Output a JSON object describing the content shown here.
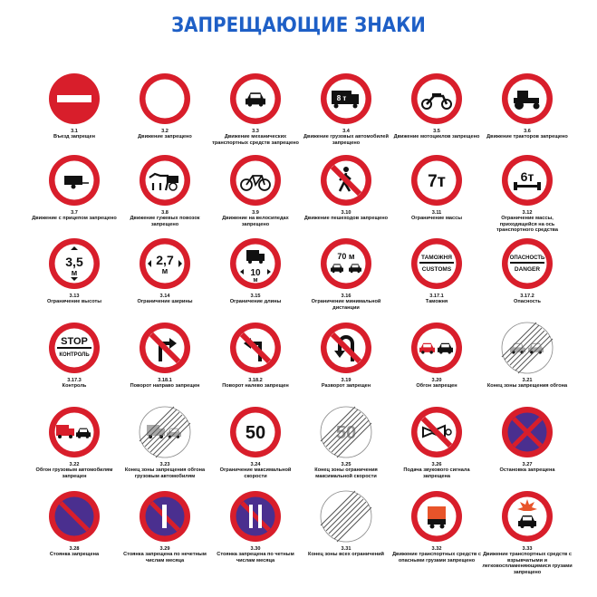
{
  "title": "ЗАПРЕЩАЮЩИЕ ЗНАКИ",
  "signs": [
    {
      "num": "3.1",
      "text": "Въезд запрещен",
      "icon": "no-entry"
    },
    {
      "num": "3.2",
      "text": "Движение запрещено",
      "icon": "plain"
    },
    {
      "num": "3.3",
      "text": "Движение механических транспортных средств запрещено",
      "icon": "car"
    },
    {
      "num": "3.4",
      "text": "Движение грузовых автомобилей запрещено",
      "icon": "truck",
      "label": "8 т"
    },
    {
      "num": "3.5",
      "text": "Движение мотоциклов запрещено",
      "icon": "motorcycle"
    },
    {
      "num": "3.6",
      "text": "Движение тракторов запрещено",
      "icon": "tractor"
    },
    {
      "num": "3.7",
      "text": "Движение с прицепом запрещено",
      "icon": "trailer"
    },
    {
      "num": "3.8",
      "text": "Движение гужевых повозок запрещено",
      "icon": "horse-cart"
    },
    {
      "num": "3.9",
      "text": "Движение на велосипедах запрещено",
      "icon": "bicycle"
    },
    {
      "num": "3.10",
      "text": "Движение пешеходов запрещено",
      "icon": "pedestrian"
    },
    {
      "num": "3.11",
      "text": "Ограничение массы",
      "icon": "text-big",
      "label": "7т"
    },
    {
      "num": "3.12",
      "text": "Ограничение массы, приходящейся на ось транспортного средства",
      "icon": "axle",
      "label": "6т"
    },
    {
      "num": "3.13",
      "text": "Ограничение высоты",
      "icon": "height",
      "label": "3,5",
      "unit": "м"
    },
    {
      "num": "3.14",
      "text": "Ограничение ширины",
      "icon": "width",
      "label": "2,7",
      "unit": "м"
    },
    {
      "num": "3.15",
      "text": "Ограничение длины",
      "icon": "length",
      "label": "10",
      "unit": "м"
    },
    {
      "num": "3.16",
      "text": "Ограничение минимальной дистанции",
      "icon": "distance",
      "label": "70 м"
    },
    {
      "num": "3.17.1",
      "text": "Таможня",
      "icon": "customs",
      "label": "ТАМОЖНЯ",
      "label2": "CUSTOMS"
    },
    {
      "num": "3.17.2",
      "text": "Опасность",
      "icon": "danger",
      "label": "ОПАСНОСТЬ",
      "label2": "DANGER"
    },
    {
      "num": "3.17.3",
      "text": "Контроль",
      "icon": "stop",
      "label": "STOP",
      "label2": "КОНТРОЛЬ"
    },
    {
      "num": "3.18.1",
      "text": "Поворот направо запрещен",
      "icon": "no-right-turn"
    },
    {
      "num": "3.18.2",
      "text": "Поворот налево запрещен",
      "icon": "no-left-turn"
    },
    {
      "num": "3.19",
      "text": "Разворот запрещен",
      "icon": "no-u-turn"
    },
    {
      "num": "3.20",
      "text": "Обгон запрещен",
      "icon": "no-overtaking"
    },
    {
      "num": "3.21",
      "text": "Конец зоны запрещения обгона",
      "icon": "end-no-overtaking"
    },
    {
      "num": "3.22",
      "text": "Обгон грузовым автомобилям запрещен",
      "icon": "no-truck-overtaking"
    },
    {
      "num": "3.23",
      "text": "Конец зоны запрещения обгона грузовым автомобилям",
      "icon": "end-no-truck-overtaking"
    },
    {
      "num": "3.24",
      "text": "Ограничение максимальной скорости",
      "icon": "speed-limit",
      "label": "50"
    },
    {
      "num": "3.25",
      "text": "Конец зоны ограничения максимальной скорости",
      "icon": "end-speed-limit",
      "label": "50"
    },
    {
      "num": "3.26",
      "text": "Подача звукового сигнала запрещена",
      "icon": "no-horn"
    },
    {
      "num": "3.27",
      "text": "Остановка запрещена",
      "icon": "no-stopping"
    },
    {
      "num": "3.28",
      "text": "Стоянка запрещена",
      "icon": "no-parking"
    },
    {
      "num": "3.29",
      "text": "Стоянка запрещена по нечетным числам месяца",
      "icon": "no-parking-odd"
    },
    {
      "num": "3.30",
      "text": "Стоянка запрещена по четным числам месяца",
      "icon": "no-parking-even"
    },
    {
      "num": "3.31",
      "text": "Конец зоны всех ограничений",
      "icon": "end-all"
    },
    {
      "num": "3.32",
      "text": "Движение транспортных средств с опасными грузами запрещено",
      "icon": "dangerous-goods"
    },
    {
      "num": "3.33",
      "text": "Движение транспортных средств с взрывчатыми и легковоспламеняющимися грузами запрещено",
      "icon": "explosives"
    }
  ],
  "colors": {
    "red": "#d81e2b",
    "blue": "#4a2f8f",
    "title_blue": "#1e5fc6",
    "orange": "#e8542a"
  }
}
